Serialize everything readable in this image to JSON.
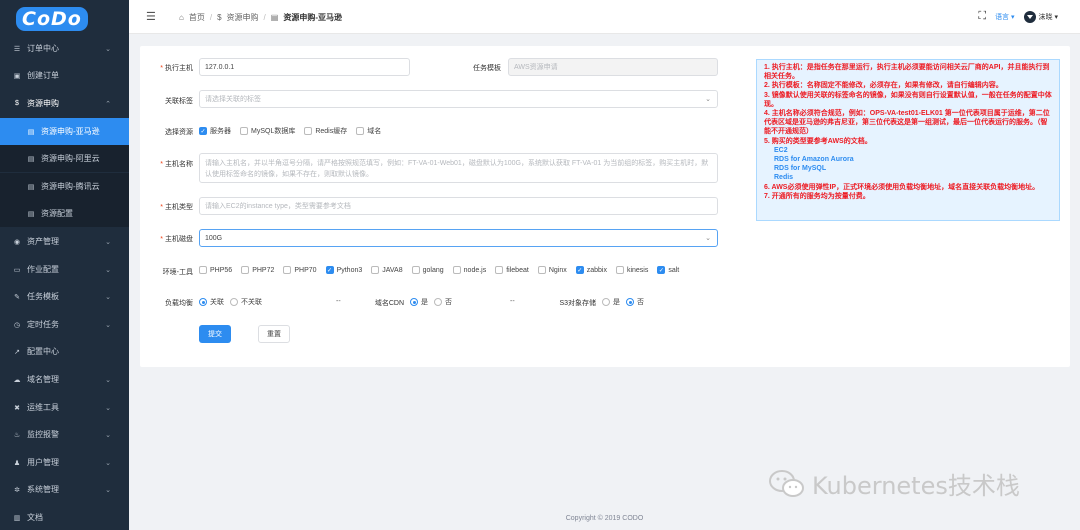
{
  "app": {
    "logo_text": "CoDo"
  },
  "sidebar": {
    "items": [
      {
        "label": "订单中心",
        "icon": "list-icon",
        "chevron": "⌄"
      },
      {
        "label": "创建订单",
        "icon": "cart-icon",
        "chevron": ""
      },
      {
        "label": "资源申购",
        "icon": "dollar-icon",
        "chevron": "⌃"
      },
      {
        "label": "资源申购-亚马逊",
        "icon": "doc-icon",
        "chevron": ""
      },
      {
        "label": "资源申购-阿里云",
        "icon": "doc-icon",
        "chevron": ""
      },
      {
        "label": "资源申购-腾讯云",
        "icon": "doc-icon",
        "chevron": ""
      },
      {
        "label": "资源配置",
        "icon": "doc-icon",
        "chevron": ""
      },
      {
        "label": "资产管理",
        "icon": "asset-icon",
        "chevron": "⌄"
      },
      {
        "label": "作业配置",
        "icon": "job-icon",
        "chevron": "⌄"
      },
      {
        "label": "任务模板",
        "icon": "template-icon",
        "chevron": "⌄"
      },
      {
        "label": "定时任务",
        "icon": "clock-icon",
        "chevron": "⌄"
      },
      {
        "label": "配置中心",
        "icon": "config-icon",
        "chevron": ""
      },
      {
        "label": "域名管理",
        "icon": "domain-icon",
        "chevron": "⌄"
      },
      {
        "label": "运维工具",
        "icon": "tools-icon",
        "chevron": "⌄"
      },
      {
        "label": "监控报警",
        "icon": "alarm-icon",
        "chevron": "⌄"
      },
      {
        "label": "用户管理",
        "icon": "user-icon",
        "chevron": "⌄"
      },
      {
        "label": "系统管理",
        "icon": "gear-icon",
        "chevron": "⌄"
      },
      {
        "label": "文档",
        "icon": "book-icon",
        "chevron": ""
      }
    ]
  },
  "header": {
    "breadcrumb": [
      "首页",
      "资源申购",
      "资源申购-亚马逊"
    ],
    "breadcrumb_sep": "/",
    "lang_label": "语言",
    "user_name": "沫晓"
  },
  "form": {
    "host_label": "执行主机",
    "host_value": "127.0.0.1",
    "template_label": "任务模板",
    "template_value": "AWS资源申请",
    "tag_label": "关联标签",
    "tag_placeholder": "请选择关联的标签",
    "resource_label": "选择资源",
    "resources": [
      {
        "label": "服务器",
        "checked": true
      },
      {
        "label": "MySQL数据库",
        "checked": false
      },
      {
        "label": "Redis缓存",
        "checked": false
      },
      {
        "label": "域名",
        "checked": false
      }
    ],
    "hostname_label": "主机名称",
    "hostname_placeholder": "请输入主机名，并以半角逗号分隔，请严格按照规范填写，例如：FT-VA-01-Web01，磁盘默认为100G，系统默认获取 FT-VA-01 为当前组的标签，购买主机时，默认使用标签命名的镜像，如果不存在，则取默认镜像。",
    "hosttype_label": "主机类型",
    "hosttype_placeholder": "请输入EC2的instance type，类型需要参考文档",
    "disk_label": "主机磁盘",
    "disk_value": "100G",
    "env_label": "环境-工具",
    "env_tools": [
      {
        "label": "PHP56",
        "checked": false
      },
      {
        "label": "PHP72",
        "checked": false
      },
      {
        "label": "PHP70",
        "checked": false
      },
      {
        "label": "Python3",
        "checked": true
      },
      {
        "label": "JAVA8",
        "checked": false
      },
      {
        "label": "golang",
        "checked": false
      },
      {
        "label": "node.js",
        "checked": false
      },
      {
        "label": "filebeat",
        "checked": false
      },
      {
        "label": "Nginx",
        "checked": false
      },
      {
        "label": "zabbix",
        "checked": true
      },
      {
        "label": "kinesis",
        "checked": false
      },
      {
        "label": "salt",
        "checked": true
      }
    ],
    "lb_label": "负载均衡",
    "lb_options": [
      {
        "label": "关联",
        "selected": true
      },
      {
        "label": "不关联",
        "selected": false
      }
    ],
    "dash": "--",
    "cdn_label": "域名CDN",
    "cdn_options": [
      {
        "label": "是",
        "selected": true
      },
      {
        "label": "否",
        "selected": false
      }
    ],
    "s3_label": "S3对象存储",
    "s3_options": [
      {
        "label": "是",
        "selected": false
      },
      {
        "label": "否",
        "selected": true
      }
    ],
    "submit_label": "提交",
    "reset_label": "重置"
  },
  "notes": [
    "1. 执行主机：是指任务在那里运行，执行主机必须要能访问相关云厂商的API，并且能执行到相关任务。",
    "2. 执行模板：名称固定不能修改，必须存在，如果有修改，请自行编辑内容。",
    "3. 镜像默认使用关联的标签命名的镜像，如果没有则自行设置默认值，一般在任务的配置中体现。",
    "4. 主机名称必须符合规范，例如：OPS-VA-test01-ELK01 第一位代表项目属于运维，第二位代表区域是亚马逊的弗吉尼亚，第三位代表这是第一组测试，最后一位代表运行的服务。（智能不开通规范）",
    "5. 购买的类型要参考AWS的文档。",
    "EC2",
    "RDS for Amazon Aurora",
    "RDS for MySQL",
    "Redis",
    "6. AWS必须使用弹性IP，正式环境必须使用负载均衡地址，域名直接关联负载均衡地址。",
    "7. 开通所有的服务均为按量付费。"
  ],
  "footer": {
    "copyright": "Copyright © 2019 CODO"
  },
  "watermark": {
    "text": "Kubernetes技术栈"
  },
  "colors": {
    "sidebar_bg": "#1f2d3d",
    "accent": "#2d8cf0",
    "note_text": "#ed1c24",
    "note_bg": "#e6f3ff"
  }
}
